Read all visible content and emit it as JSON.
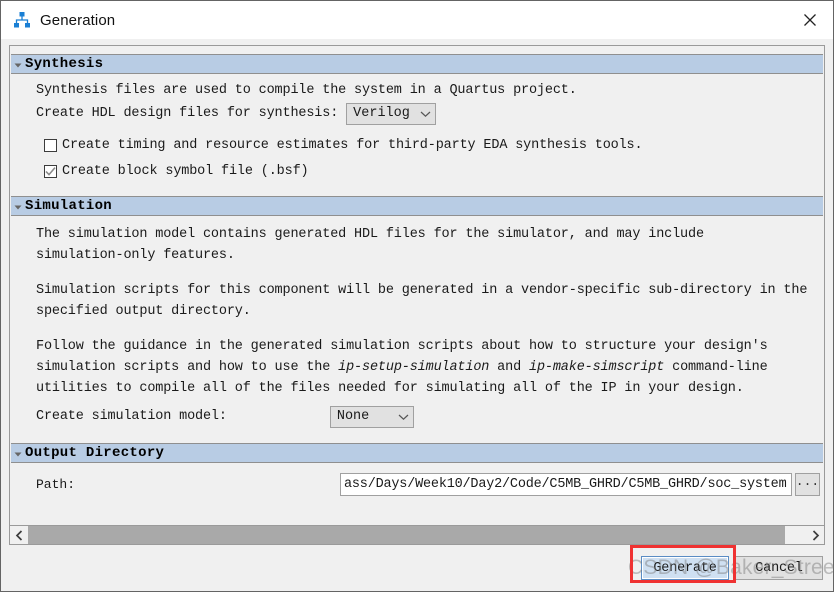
{
  "window": {
    "title": "Generation",
    "icon": "hierarchy-icon",
    "close_label": "×"
  },
  "synthesis": {
    "header": "Synthesis",
    "paragraph": "Synthesis files are used to compile the system in a Quartus project.",
    "hdl_label": "Create HDL design files for synthesis:",
    "hdl_value": "Verilog",
    "checkbox_timing": {
      "label": "Create timing and resource estimates for third-party EDA synthesis tools.",
      "checked": false
    },
    "checkbox_bsf": {
      "label": "Create block symbol file (.bsf)",
      "checked": true
    }
  },
  "simulation": {
    "header": "Simulation",
    "paragraph1_line1": "The simulation model contains generated HDL files for the simulator, and may include",
    "paragraph1_line2": "simulation-only features.",
    "paragraph2_line1": "Simulation scripts for this component will be generated in a vendor-specific sub-directory in the",
    "paragraph2_line2": "specified output directory.",
    "paragraph3_line1": "Follow the guidance in the generated simulation scripts about how to structure your design's",
    "paragraph3_line2_a": "simulation scripts and how to use the ",
    "paragraph3_line2_em1": "ip-setup-simulation",
    "paragraph3_line2_b": " and ",
    "paragraph3_line2_em2": "ip-make-simscript",
    "paragraph3_line2_c": " command-line",
    "paragraph3_line3": "utilities to compile all of the files needed for simulating all of the IP in your design.",
    "model_label": "Create simulation model:",
    "model_value": "None"
  },
  "output_directory": {
    "header": "Output Directory",
    "path_label": "Path:",
    "path_value": "ass/Days/Week10/Day2/Code/C5MB_GHRD/C5MB_GHRD/soc_system",
    "browse_label": "..."
  },
  "scrollbar": {
    "left_arrow": "‹",
    "right_arrow": "›"
  },
  "buttons": {
    "generate": "Generate",
    "cancel": "Cancel"
  },
  "annotation": {
    "highlight_color": "#ef3232",
    "watermark": "CSDN @Baker_Streets"
  },
  "colors": {
    "section_header_bg": "#b8cce4",
    "dialog_bg": "#f0f0f0",
    "primary_button_bg": "#cfe0f2"
  }
}
